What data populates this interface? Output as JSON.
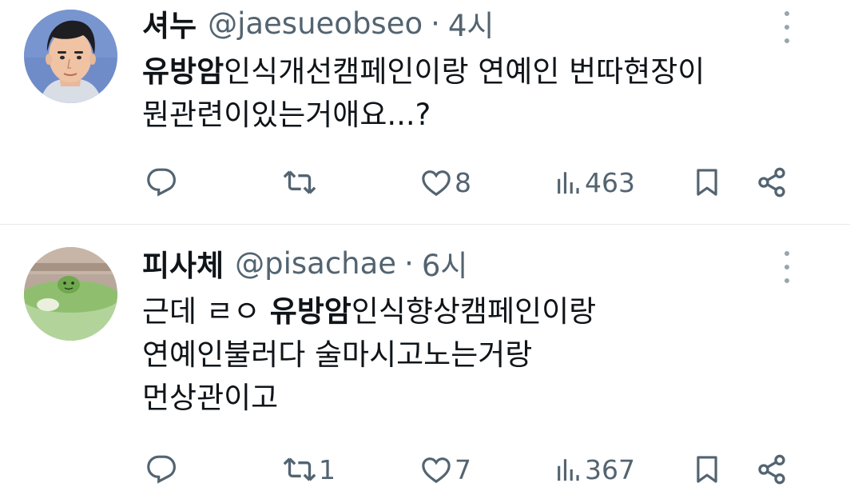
{
  "tweets": [
    {
      "name": "셔누",
      "handle": "@jaesueobseo",
      "separator": "·",
      "time": "4시",
      "lines": [
        {
          "bold": "유방암",
          "rest": "인식개선캠페인이랑 연예인 번따현장이"
        },
        {
          "bold": "",
          "rest": "뭔관련이있는거애요...?"
        }
      ],
      "actions": {
        "replies": "",
        "retweets": "",
        "likes": "8",
        "views": "463"
      }
    },
    {
      "name": "피사체",
      "handle": "@pisachae",
      "separator": "·",
      "time": "6시",
      "lines": [
        {
          "prefix": "근데 ㄹㅇ ",
          "bold": "유방암",
          "rest": "인식향상캠페인이랑"
        },
        {
          "bold": "",
          "rest": "연예인불러다 술마시고노는거랑"
        },
        {
          "bold": "",
          "rest": "먼상관이고"
        }
      ],
      "actions": {
        "replies": "",
        "retweets": "1",
        "likes": "7",
        "views": "367"
      }
    }
  ],
  "colors": {
    "text": "#0f1419",
    "muted": "#536471",
    "divider": "#e6e9eb",
    "icon": "#536471"
  },
  "icons": [
    "reply-icon",
    "retweet-icon",
    "heart-icon",
    "views-icon",
    "bookmark-icon",
    "share-icon",
    "more-icon"
  ]
}
